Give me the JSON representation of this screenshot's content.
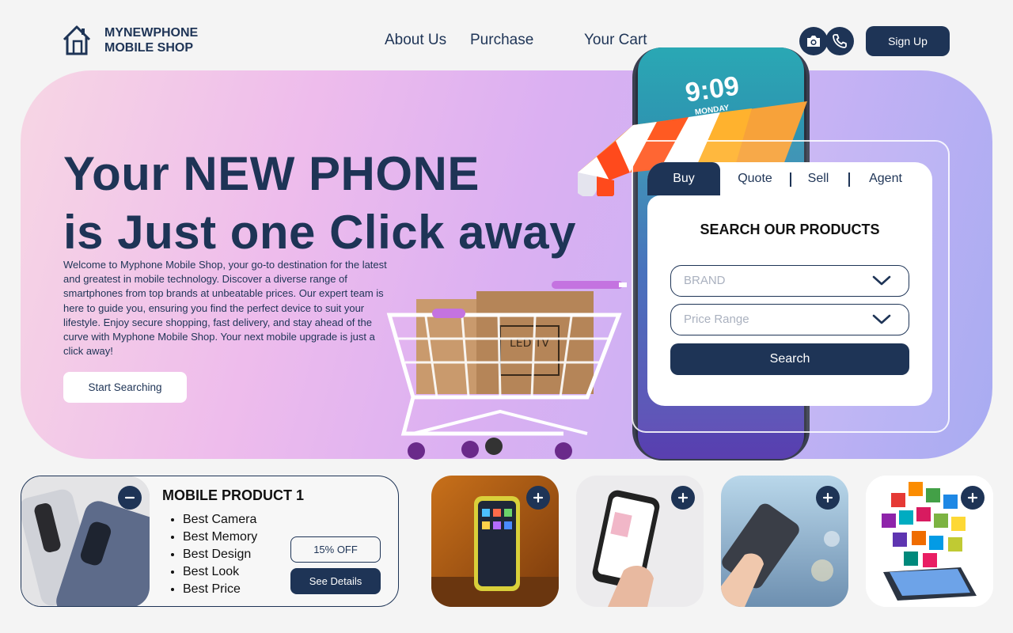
{
  "brand": {
    "line1": "MYNEWPHONE",
    "line2": "MOBILE SHOP"
  },
  "nav": {
    "about": "About Us",
    "purchase": "Purchase",
    "cart": "Your Cart"
  },
  "header": {
    "signup_label": "Sign Up",
    "icons": [
      "camera-icon",
      "phone-icon"
    ]
  },
  "hero": {
    "title_line1": "Your NEW PHONE",
    "title_line2": "is Just one Click away",
    "description": "Welcome to Myphone Mobile Shop, your go-to destination for the latest and greatest in mobile technology. Discover a diverse range of smartphones from top brands at unbeatable prices. Our expert team is here to guide you, ensuring you find the perfect device to suit your lifestyle. Enjoy secure shopping, fast delivery, and stay ahead of the curve with Myphone Mobile Shop. Your next mobile upgrade is just a click away!",
    "start_button": "Start Searching",
    "phone_time": "9:09",
    "phone_day": "MONDAY",
    "box_label": "LED TV"
  },
  "search": {
    "tabs": [
      "Buy",
      "Quote",
      "Sell",
      "Agent"
    ],
    "active_tab": "Buy",
    "title": "SEARCH OUR PRODUCTS",
    "brand_placeholder": "BRAND",
    "price_placeholder": "Price Range",
    "button": "Search"
  },
  "product": {
    "title": "MOBILE PRODUCT 1",
    "features": [
      "Best Camera",
      "Best Memory",
      "Best Design",
      "Best Look",
      "Best Price"
    ],
    "discount": "15% OFF",
    "details_button": "See Details"
  },
  "colors": {
    "primary": "#1e3456",
    "background": "#f4f4f4"
  }
}
